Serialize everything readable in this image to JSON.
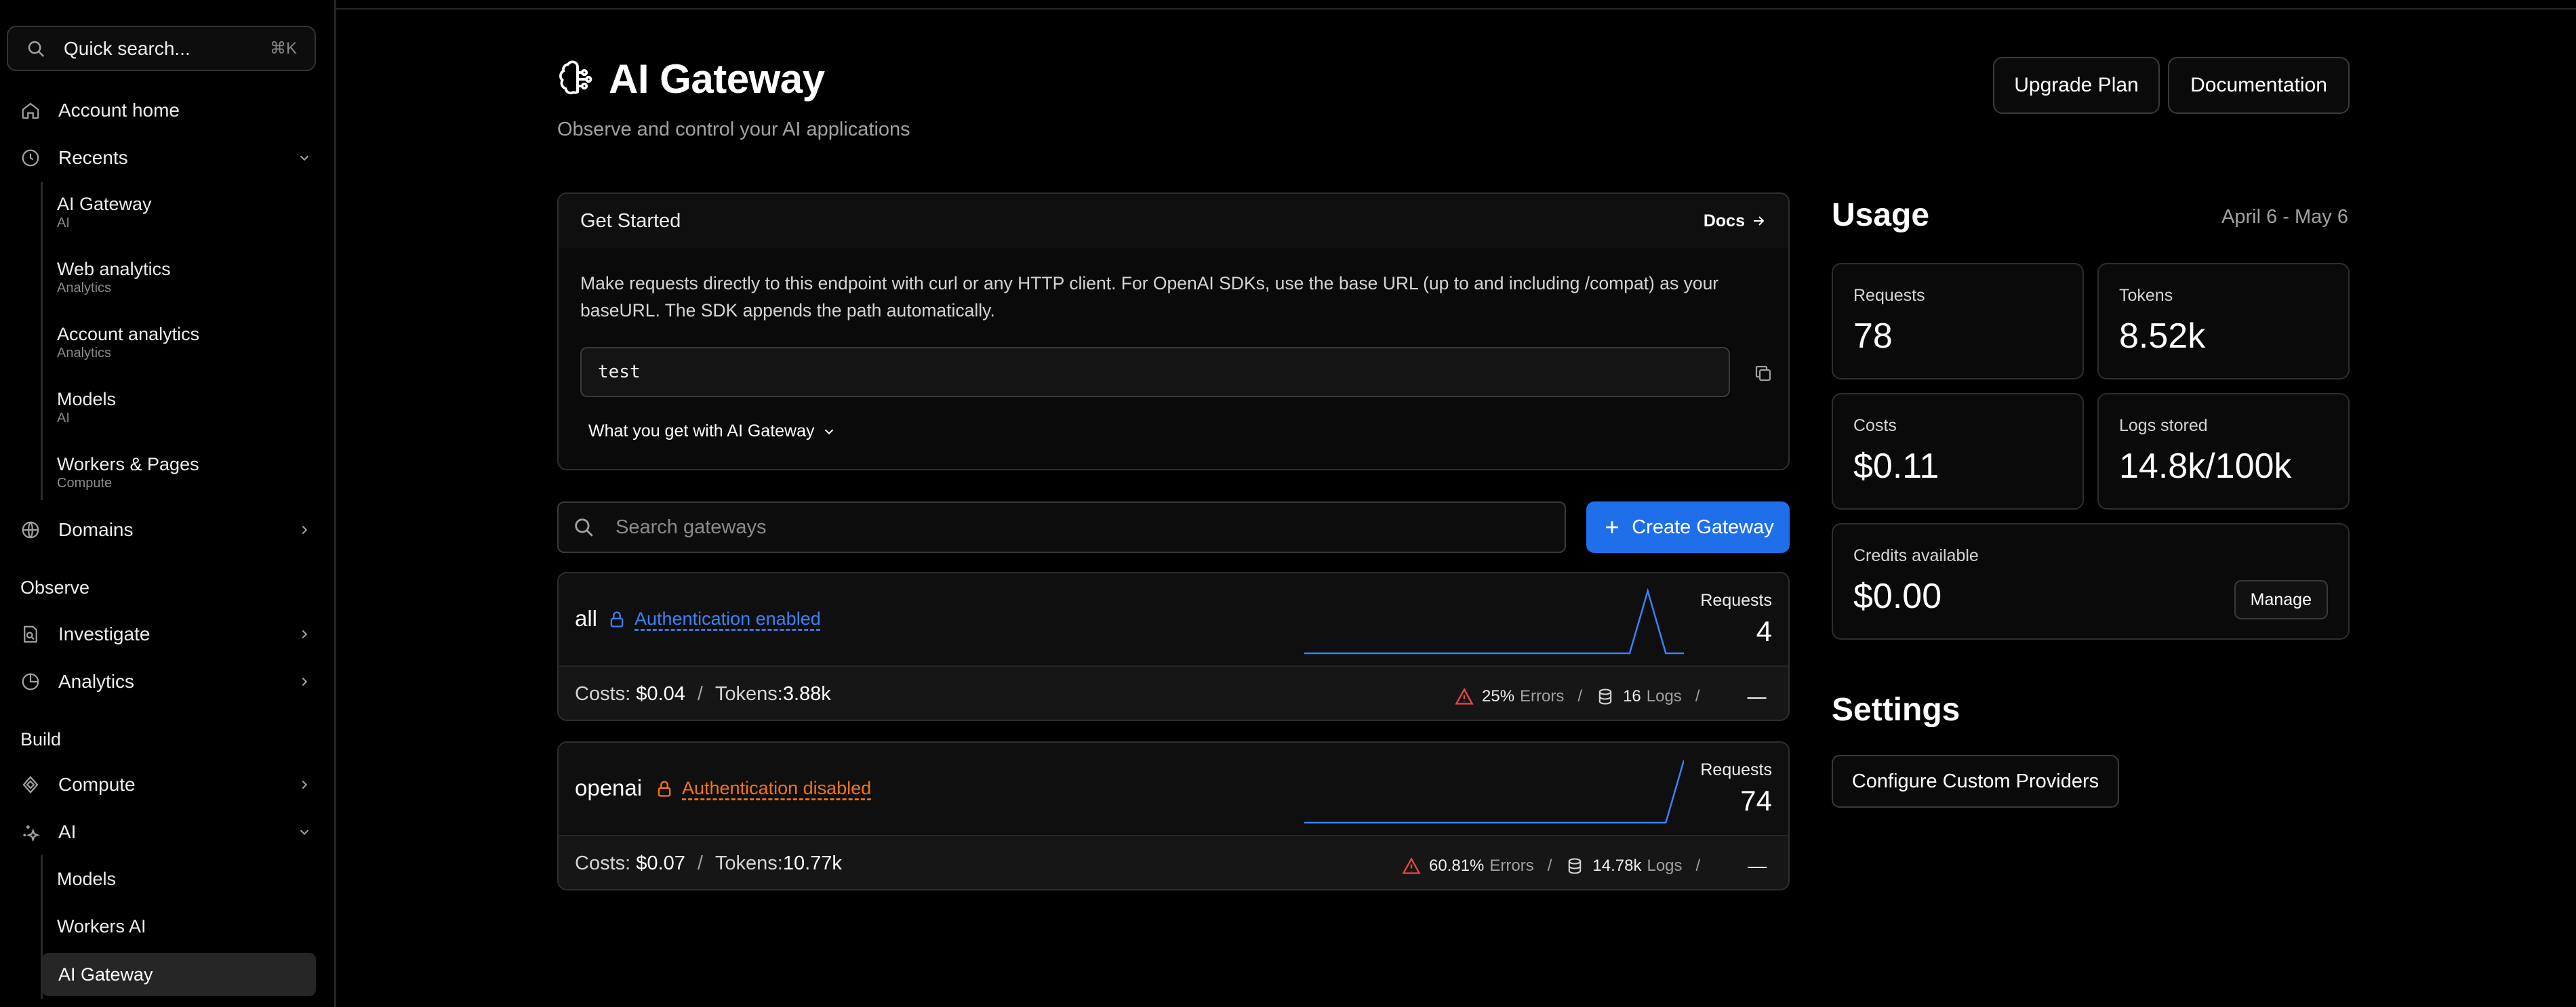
{
  "sidebar": {
    "search": {
      "label": "Quick search...",
      "shortcut": "⌘K"
    },
    "account_home": "Account home",
    "recents": {
      "label": "Recents",
      "items": [
        {
          "title": "AI Gateway",
          "sub": "AI"
        },
        {
          "title": "Web analytics",
          "sub": "Analytics"
        },
        {
          "title": "Account analytics",
          "sub": "Analytics"
        },
        {
          "title": "Models",
          "sub": "AI"
        },
        {
          "title": "Workers & Pages",
          "sub": "Compute"
        }
      ]
    },
    "domains": "Domains",
    "observe_label": "Observe",
    "investigate": "Investigate",
    "analytics": "Analytics",
    "build_label": "Build",
    "compute": "Compute",
    "ai": {
      "label": "AI",
      "items": [
        "Models",
        "Workers AI",
        "AI Gateway"
      ]
    }
  },
  "header": {
    "title": "AI Gateway",
    "subtitle": "Observe and control your AI applications",
    "upgrade": "Upgrade Plan",
    "documentation": "Documentation"
  },
  "get_started": {
    "title": "Get Started",
    "docs": "Docs",
    "description": "Make requests directly to this endpoint with curl or any HTTP client. For OpenAI SDKs, use the base URL (up to and including /compat) as your baseURL. The SDK appends the path automatically.",
    "endpoint": "test",
    "what_you_get": "What you get with AI Gateway"
  },
  "gateways": {
    "search_placeholder": "Search gateways",
    "create": "Create Gateway",
    "items": [
      {
        "name": "all",
        "auth": "Authentication enabled",
        "requests_label": "Requests",
        "requests": "4",
        "costs_label": "Costs:",
        "costs": "$0.04",
        "tokens_label": "Tokens:",
        "tokens": "3.88k",
        "errors_pct": "25%",
        "errors_label": "Errors",
        "logs": "16",
        "logs_label": "Logs",
        "dash": "—",
        "sparkline": [
          0,
          0,
          0,
          0,
          0,
          0,
          0,
          0,
          0,
          0,
          0,
          0,
          0,
          0,
          0,
          0,
          0,
          0,
          0,
          4,
          0,
          0
        ]
      },
      {
        "name": "openai",
        "auth": "Authentication disabled",
        "requests_label": "Requests",
        "requests": "74",
        "costs_label": "Costs:",
        "costs": "$0.07",
        "tokens_label": "Tokens:",
        "tokens": "10.77k",
        "errors_pct": "60.81%",
        "errors_label": "Errors",
        "logs": "14.78k",
        "logs_label": "Logs",
        "dash": "—",
        "sparkline": [
          0,
          0,
          0,
          0,
          0,
          0,
          0,
          0,
          0,
          0,
          0,
          0,
          0,
          0,
          0,
          0,
          0,
          0,
          0,
          0,
          0,
          74
        ]
      }
    ]
  },
  "usage": {
    "title": "Usage",
    "range": "April 6 - May 6",
    "requests_label": "Requests",
    "requests": "78",
    "tokens_label": "Tokens",
    "tokens": "8.52k",
    "costs_label": "Costs",
    "costs": "$0.11",
    "logs_label": "Logs stored",
    "logs": "14.8k/100k",
    "credits_label": "Credits available",
    "credits": "$0.00",
    "manage": "Manage"
  },
  "settings": {
    "title": "Settings",
    "configure": "Configure Custom Providers"
  },
  "colors": {
    "accent": "#1f6feb",
    "auth_enabled": "#3b82f6",
    "auth_disabled": "#f97316",
    "error": "#ef4444",
    "sparkline": "#3b82f6"
  }
}
